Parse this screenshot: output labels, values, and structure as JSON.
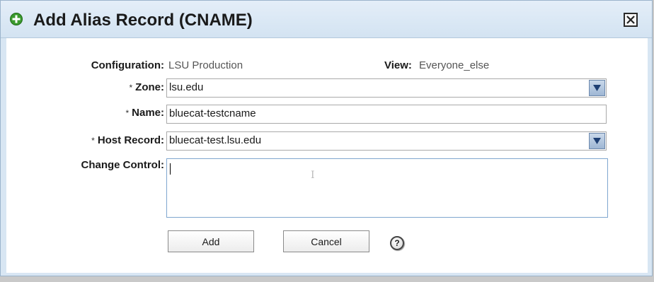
{
  "dialog": {
    "title": "Add Alias Record (CNAME)",
    "close_icon": "close-icon",
    "title_icon": "add-green-icon"
  },
  "form": {
    "configuration": {
      "label": "Configuration:",
      "value": "LSU Production"
    },
    "view": {
      "label": "View:",
      "value": "Everyone_else"
    },
    "zone": {
      "required": "*",
      "label": "Zone:",
      "value": "lsu.edu"
    },
    "name": {
      "required": "*",
      "label": "Name:",
      "value": "bluecat-testcname"
    },
    "host_record": {
      "required": "*",
      "label": "Host Record:",
      "value": "bluecat-test.lsu.edu"
    },
    "change_control": {
      "label": "Change Control:",
      "value": ""
    }
  },
  "buttons": {
    "add": "Add",
    "cancel": "Cancel",
    "help": "?"
  },
  "colors": {
    "title_bar": "#d8e6f3",
    "dropdown_button": "#9fb7d4",
    "add_icon": "#3a9a2e"
  }
}
